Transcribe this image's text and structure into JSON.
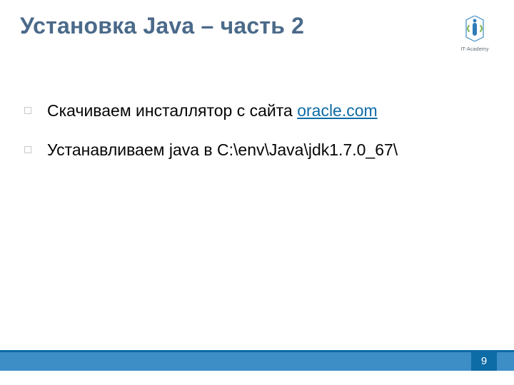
{
  "title": "Установка Java – часть 2",
  "logo": {
    "caption": "IT-Academy"
  },
  "bullets": [
    {
      "prefix": "Скачиваем инсталлятор с сайта ",
      "link": "oracle.com",
      "suffix": ""
    },
    {
      "prefix": "Устанавливаем java в С:\\env\\Java\\jdk1.7.0_67\\",
      "link": "",
      "suffix": ""
    }
  ],
  "page_number": "9"
}
